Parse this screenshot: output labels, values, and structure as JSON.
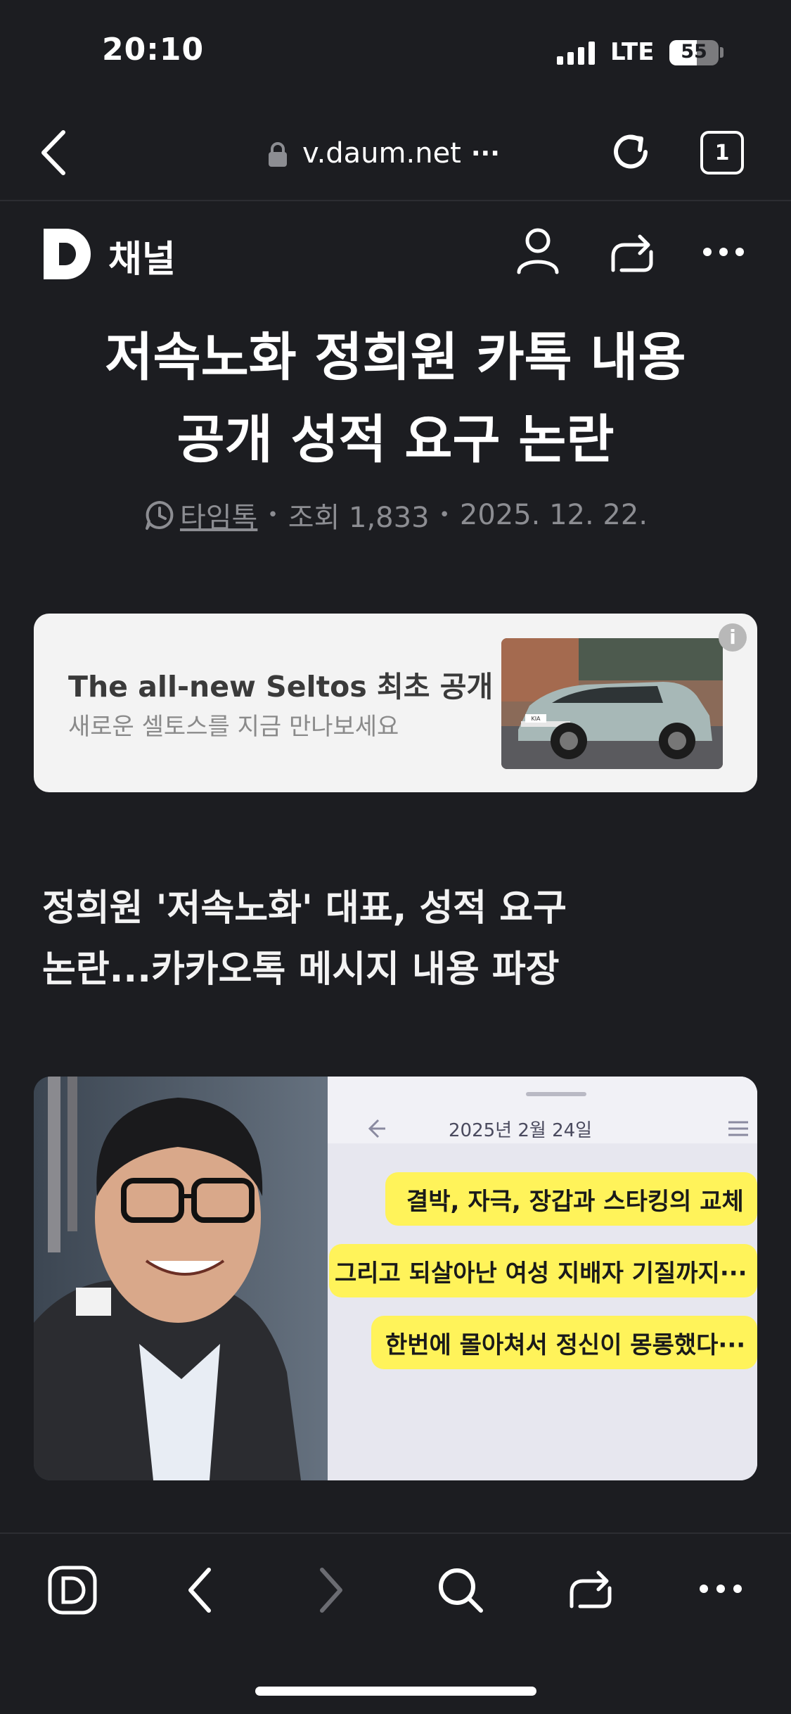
{
  "status_bar": {
    "time": "20:10",
    "network": "LTE",
    "battery_level": "55",
    "battery_fraction": 0.55
  },
  "browser": {
    "url": "v.daum.net",
    "url_more": "···",
    "tab_count": "1"
  },
  "channel": {
    "logo_letter": "D",
    "label": "채널"
  },
  "article": {
    "title_line1": "저속노화 정희원 카톡 내용",
    "title_line2": "공개 성적 요구 논란",
    "source": "타임톡",
    "views": "조회 1,833",
    "date": "2025. 12. 22.",
    "separator": "•",
    "subheadline_line1": "정희원 '저속노화' 대표, 성적 요구",
    "subheadline_line2": "논란...카카오톡 메시지 내용 파장"
  },
  "ad": {
    "title": "The all-new Seltos 최초 공개",
    "subtitle": "새로운 셀토스를 지금 만나보세요",
    "info": "i",
    "plate": "KIA"
  },
  "image_chat": {
    "date": "2025년 2월 24일",
    "bubbles": [
      "결박, 자극, 장갑과 스타킹의 교체",
      "그리고 되살아난 여성 지배자 기질까지···",
      "한번에 몰아쳐서 정신이 몽롱했다···"
    ]
  },
  "colors": {
    "background": "#1c1d21",
    "bubble": "#fff35a",
    "muted": "#8c8d92"
  }
}
